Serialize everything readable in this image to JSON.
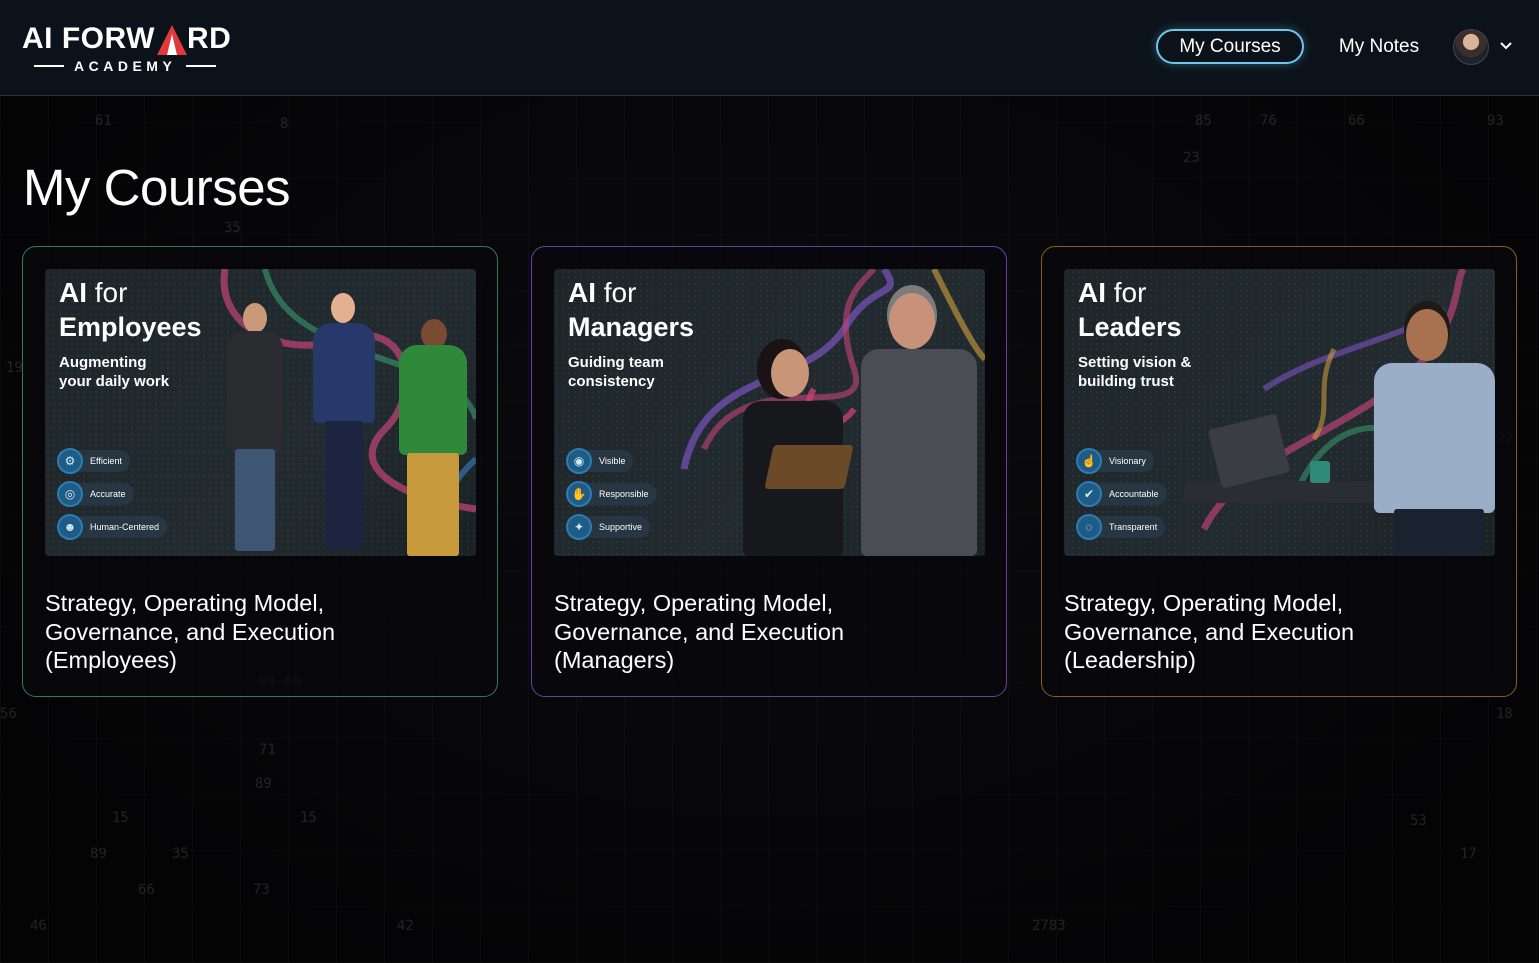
{
  "header": {
    "logo": {
      "line1_left": "AI FORW",
      "line1_right": "RD",
      "line2": "ACADEMY",
      "accent_color": "#e0383b"
    },
    "nav": {
      "my_courses": "My Courses",
      "my_notes": "My Notes"
    },
    "profile_menu_icon": "chevron-down-icon"
  },
  "main": {
    "title": "My Courses",
    "courses": [
      {
        "thumb_ai": "AI",
        "thumb_for": "for",
        "thumb_role": "Employees",
        "thumb_subtitle_1": "Augmenting",
        "thumb_subtitle_2": "your daily work",
        "badges": [
          {
            "icon": "gear-icon",
            "label": "Efficient"
          },
          {
            "icon": "target-icon",
            "label": "Accurate"
          },
          {
            "icon": "people-icon",
            "label": "Human-Centered"
          }
        ],
        "title_1": "Strategy, Operating Model,",
        "title_2": "Governance, and Execution",
        "title_3": "(Employees)",
        "border_color": "#2f7a5a"
      },
      {
        "thumb_ai": "AI",
        "thumb_for": "for",
        "thumb_role": "Managers",
        "thumb_subtitle_1": "Guiding team",
        "thumb_subtitle_2": "consistency",
        "badges": [
          {
            "icon": "eye-icon",
            "label": "Visible"
          },
          {
            "icon": "handshake-icon",
            "label": "Responsible"
          },
          {
            "icon": "support-icon",
            "label": "Supportive"
          }
        ],
        "title_1": "Strategy, Operating Model,",
        "title_2": "Governance, and Execution",
        "title_3": "(Managers)",
        "border_color": "#6a3fa0"
      },
      {
        "thumb_ai": "AI",
        "thumb_for": "for",
        "thumb_role": "Leaders",
        "thumb_subtitle_1": "Setting vision &",
        "thumb_subtitle_2": "building trust",
        "badges": [
          {
            "icon": "hand-icon",
            "label": "Visionary"
          },
          {
            "icon": "person-check-icon",
            "label": "Accountable"
          },
          {
            "icon": "transparent-icon",
            "label": "Transparent"
          }
        ],
        "title_1": "Strategy, Operating Model,",
        "title_2": "Governance, and Execution",
        "title_3": "(Leadership)",
        "border_color": "#8a5a22"
      }
    ]
  }
}
